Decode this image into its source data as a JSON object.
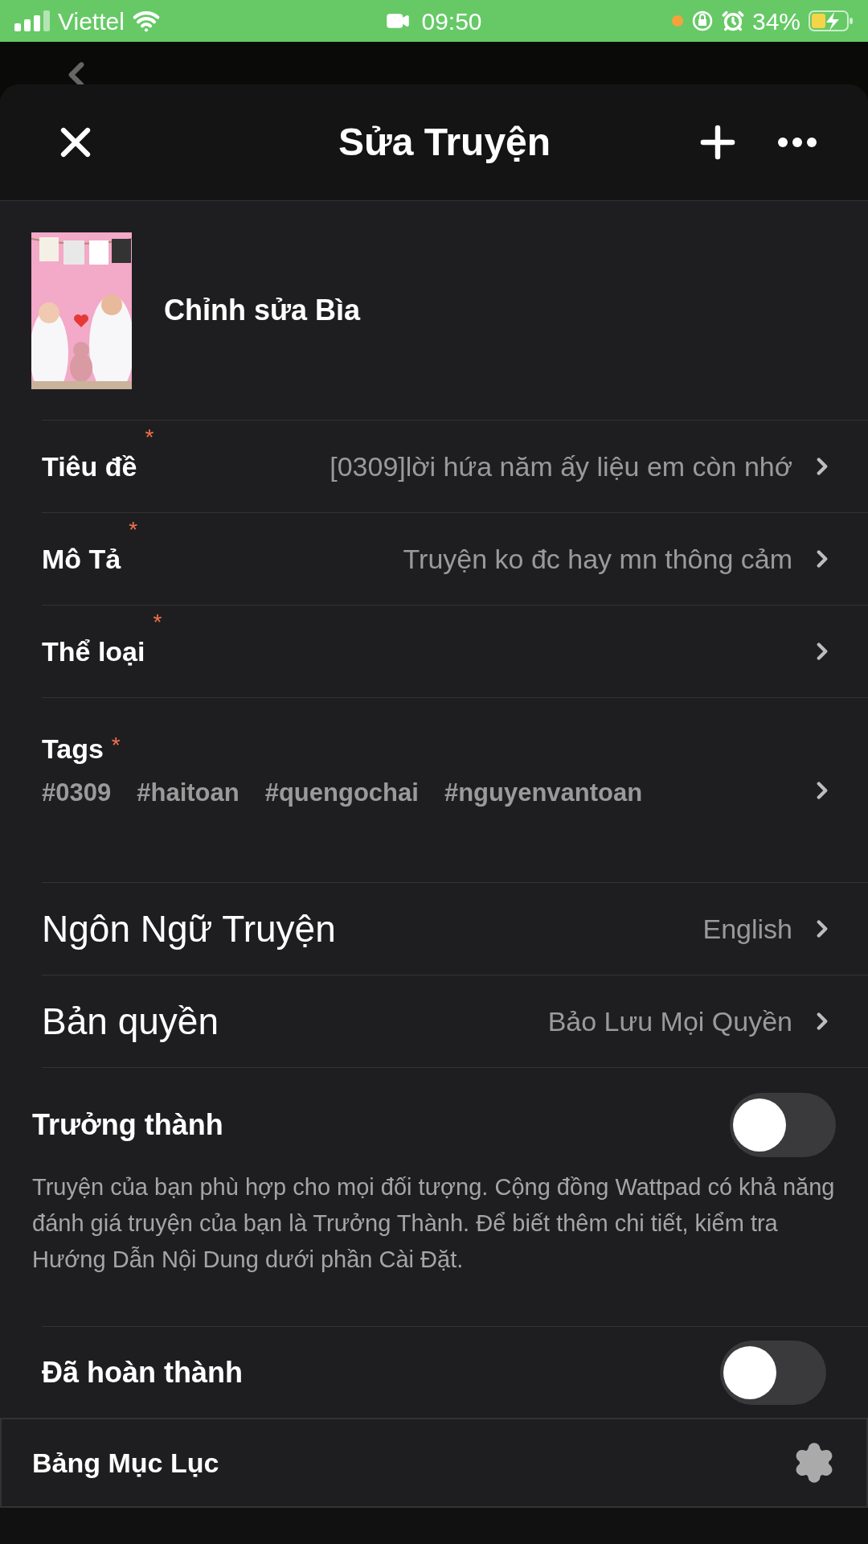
{
  "status_bar": {
    "carrier": "Viettel",
    "time": "09:50",
    "battery": "34%"
  },
  "header": {
    "title": "Sửa Truyện"
  },
  "cover": {
    "label": "Chỉnh sửa Bìa"
  },
  "fields": [
    {
      "kind": "value",
      "label": "Tiêu đề",
      "required_mark": "*",
      "value": "[0309]lời hứa năm ấy liệu em còn nhớ"
    },
    {
      "kind": "value",
      "label": "Mô Tả",
      "required_mark": "*",
      "value": "Truyện ko đc hay mn thông cảm"
    },
    {
      "kind": "value",
      "label": "Thể loại",
      "required_mark": "*"
    },
    {
      "kind": "tags",
      "label": "Tags",
      "required_mark": "*",
      "tags": [
        "#0309",
        "#haitoan",
        "#quengochai",
        "#nguyenvantoan"
      ]
    },
    {
      "kind": "large",
      "label": "Ngôn Ngữ Truyện",
      "value": "English"
    },
    {
      "kind": "large",
      "label": "Bản quyền",
      "value": "Bảo Lưu Mọi Quyền"
    }
  ],
  "mature": {
    "label": "Trưởng thành",
    "on": false,
    "description": "Truyện của bạn phù hợp cho mọi đối tượng. Cộng đồng Wattpad có khả năng đánh giá truyện của bạn là Trưởng Thành. Để biết thêm chi tiết, kiểm tra Hướng Dẫn Nội Dung dưới phần Cài Đặt."
  },
  "completed": {
    "label": "Đã hoàn thành",
    "on": false
  },
  "footer": {
    "label": "Bảng Mục Lục"
  }
}
